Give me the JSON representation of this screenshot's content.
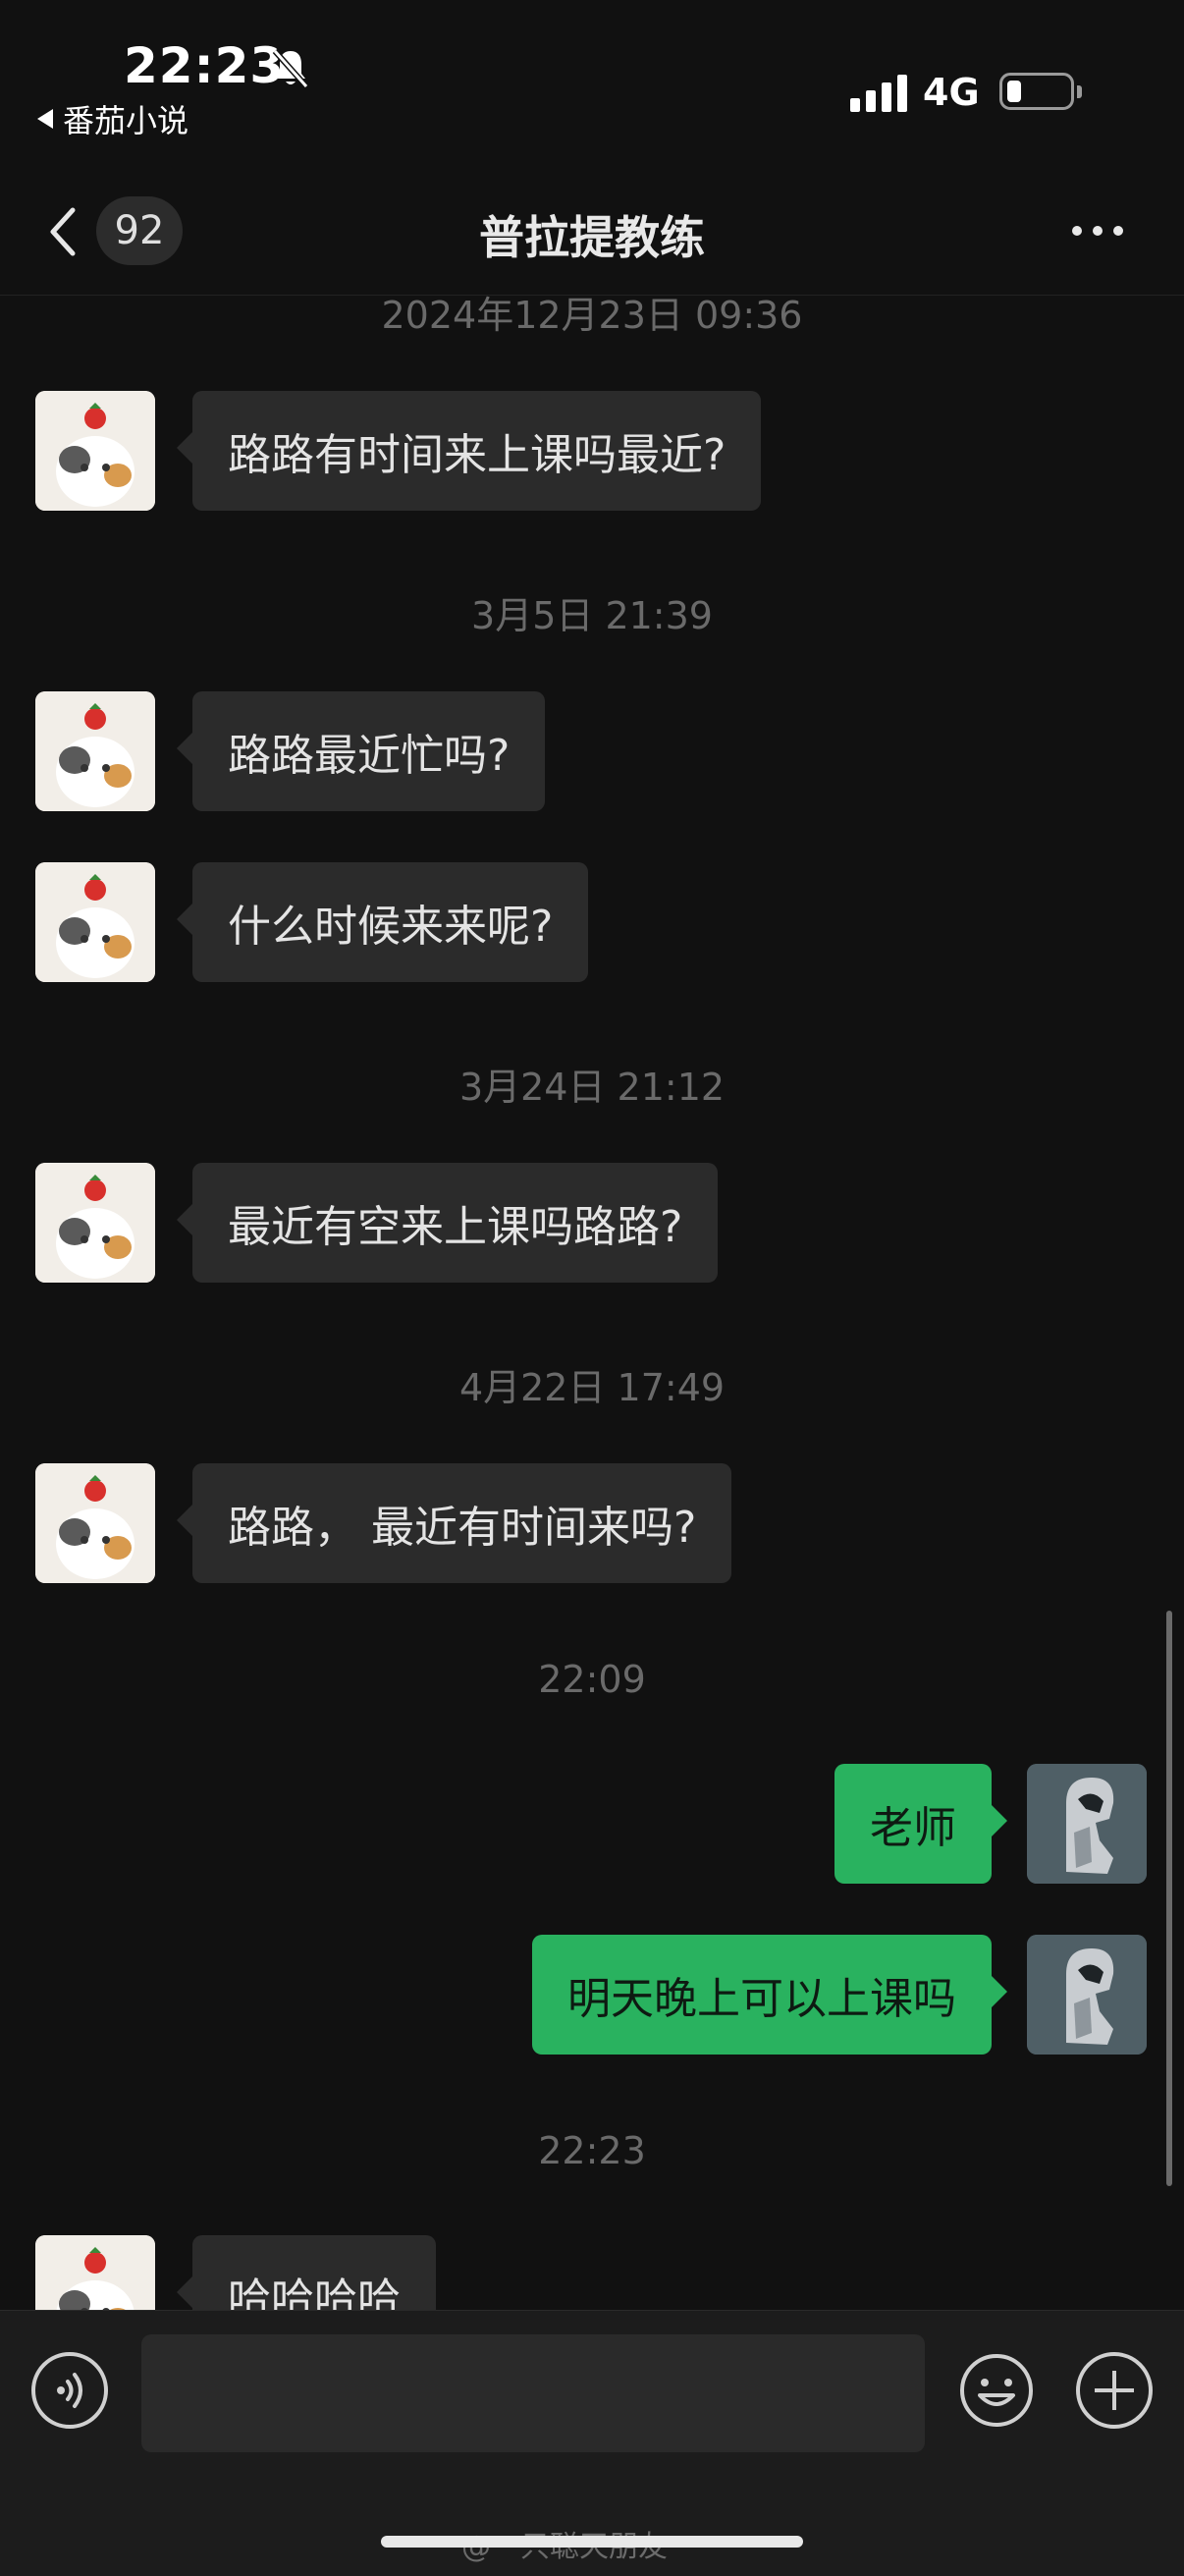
{
  "status_bar": {
    "time": "22:23",
    "back_app": "番茄小说",
    "network": "4G"
  },
  "nav": {
    "unread_count": "92",
    "title": "普拉提教练"
  },
  "messages": [
    {
      "type": "timestamp",
      "text": "2024年12月23日 09:36"
    },
    {
      "type": "incoming",
      "text": "路路有时间来上课吗最近?"
    },
    {
      "type": "timestamp",
      "text": "3月5日 21:39"
    },
    {
      "type": "incoming",
      "text": "路路最近忙吗?"
    },
    {
      "type": "incoming",
      "text": "什么时候来来呢?"
    },
    {
      "type": "timestamp",
      "text": "3月24日 21:12"
    },
    {
      "type": "incoming",
      "text": "最近有空来上课吗路路?"
    },
    {
      "type": "timestamp",
      "text": "4月22日 17:49"
    },
    {
      "type": "incoming",
      "text": "路路，  最近有时间来吗?"
    },
    {
      "type": "timestamp",
      "text": "22:09"
    },
    {
      "type": "outgoing",
      "text": "老师"
    },
    {
      "type": "outgoing",
      "text": "明天晚上可以上课吗"
    },
    {
      "type": "timestamp",
      "text": "22:23"
    },
    {
      "type": "incoming",
      "text": "哈哈哈哈"
    }
  ],
  "watermark": "@一只聪天朋友",
  "icons": {
    "back": "chevron-left-icon",
    "more": "more-dots-icon",
    "voice": "voice-icon",
    "emoji": "emoji-icon",
    "plus": "plus-icon"
  },
  "colors": {
    "background": "#111111",
    "incoming_bubble": "#2b2b2b",
    "outgoing_bubble": "#29b25f",
    "timestamp": "#6a6a6a"
  }
}
